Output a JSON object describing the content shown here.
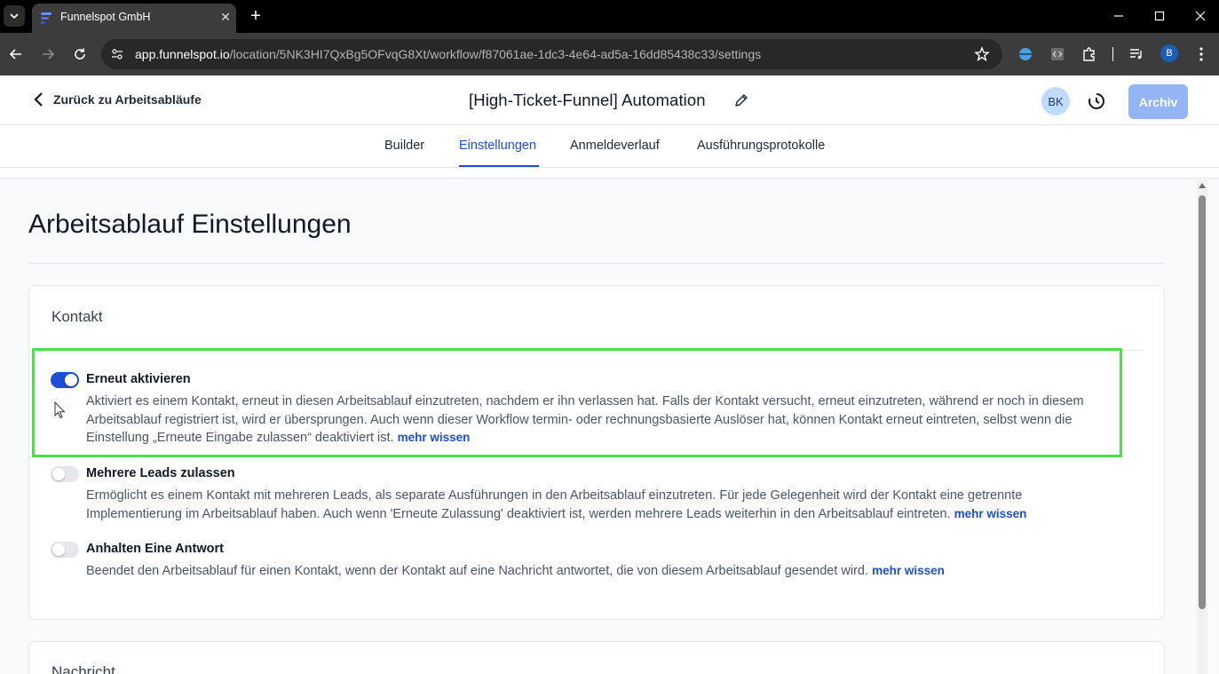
{
  "browser": {
    "tab_title": "Funnelspot GmbH",
    "url_host": "app.funnelspot.io",
    "url_path": "/location/5NK3HI7QxBg5OFvqG8Xt/workflow/f87061ae-1dc3-4e64-ad5a-16dd85438c33/settings",
    "profile_initial": "B"
  },
  "header": {
    "back_label": "Zurück zu Arbeitsabläufe",
    "workflow_title": "[High-Ticket-Funnel] Automation",
    "avatar_initials": "BK",
    "archive_label": "Archiv"
  },
  "tabs": [
    {
      "label": "Builder"
    },
    {
      "label": "Einstellungen"
    },
    {
      "label": "Anmeldeverlauf"
    },
    {
      "label": "Ausführungsprotokolle"
    }
  ],
  "page": {
    "title": "Arbeitsablauf Einstellungen"
  },
  "sections": {
    "kontakt": {
      "title": "Kontakt",
      "settings": [
        {
          "label": "Erneut aktivieren",
          "enabled": true,
          "description": "Aktiviert es einem Kontakt, erneut in diesen Arbeitsablauf einzutreten, nachdem er ihn verlassen hat. Falls der Kontakt versucht, erneut einzutreten, während er noch in diesem Arbeitsablauf registriert ist, wird er übersprungen. Auch wenn dieser Workflow termin- oder rechnungsbasierte Auslöser hat, können Kontakt erneut eintreten, selbst wenn die Einstellung „Erneute Eingabe zulassen“ deaktiviert ist.",
          "more": "mehr wissen"
        },
        {
          "label": "Mehrere Leads zulassen",
          "enabled": false,
          "description": "Ermöglicht es einem Kontakt mit mehreren Leads, als separate Ausführungen in den Arbeitsablauf einzutreten. Für jede Gelegenheit wird der Kontakt eine getrennte Implementierung im Arbeitsablauf haben. Auch wenn 'Erneute Zulassung' deaktiviert ist, werden mehrere Leads weiterhin in den Arbeitsablauf eintreten.",
          "more": "mehr wissen"
        },
        {
          "label": "Anhalten Eine Antwort",
          "enabled": false,
          "description": "Beendet den Arbeitsablauf für einen Kontakt, wenn der Kontakt auf eine Nachricht antwortet, die von diesem Arbeitsablauf gesendet wird.",
          "more": "mehr wissen"
        }
      ]
    },
    "nachricht": {
      "title": "Nachricht"
    }
  },
  "colors": {
    "accent": "#1d4ed8",
    "highlight": "#4ade4a"
  }
}
